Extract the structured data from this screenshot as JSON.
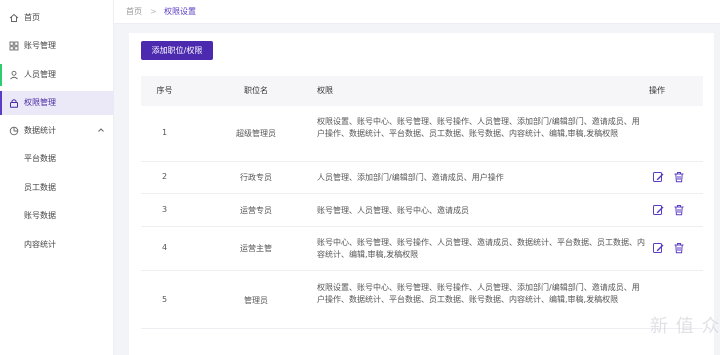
{
  "sidebar": {
    "items": [
      {
        "label": "首页",
        "icon": "home-icon"
      },
      {
        "label": "账号管理",
        "icon": "grid-icon"
      },
      {
        "label": "人员管理",
        "icon": "user-icon"
      },
      {
        "label": "权限管理",
        "icon": "lock-icon",
        "active": true
      },
      {
        "label": "数据统计",
        "icon": "chart-icon",
        "expanded": true
      },
      {
        "label": "平台数据"
      },
      {
        "label": "员工数据"
      },
      {
        "label": "账号数据"
      },
      {
        "label": "内容统计"
      }
    ]
  },
  "breadcrumb": {
    "home": "首页",
    "sep": ">",
    "current": "权限设置"
  },
  "toolbar": {
    "add_label": "添加职位/权限"
  },
  "table": {
    "headers": {
      "idx": "序号",
      "position": "职位名",
      "perms": "权限",
      "ops": "操作"
    },
    "rows": [
      {
        "idx": "1",
        "position": "超级管理员",
        "perms": "权限设置、账号中心、账号管理、账号操作、人员管理、添加部门/编辑部门、邀请成员、用户操作、数据统计、平台数据、员工数据、账号数据、内容统计、编辑,审稿,发稿权限",
        "ops": false
      },
      {
        "idx": "2",
        "position": "行政专员",
        "perms": "人员管理、添加部门/编辑部门、邀请成员、用户操作",
        "ops": true
      },
      {
        "idx": "3",
        "position": "运营专员",
        "perms": "账号管理、人员管理、账号中心、邀请成员",
        "ops": true
      },
      {
        "idx": "4",
        "position": "运营主管",
        "perms": "账号中心、账号管理、账号操作、人员管理、邀请成员、数据统计、平台数据、员工数据、内容统计、编辑,审稿,发稿权限",
        "ops": true
      },
      {
        "idx": "5",
        "position": "管理员",
        "perms": "权限设置、账号中心、账号管理、账号操作、人员管理、添加部门/编辑部门、邀请成员、用户操作、数据统计、平台数据、员工数据、账号数据、内容统计、编辑,审稿,发稿权限",
        "ops": false
      }
    ]
  },
  "watermark": "新 值 众 买",
  "colors": {
    "accent": "#4b2ab0",
    "active_bg": "#ebe9f7",
    "icon": "#5b3cc4"
  }
}
